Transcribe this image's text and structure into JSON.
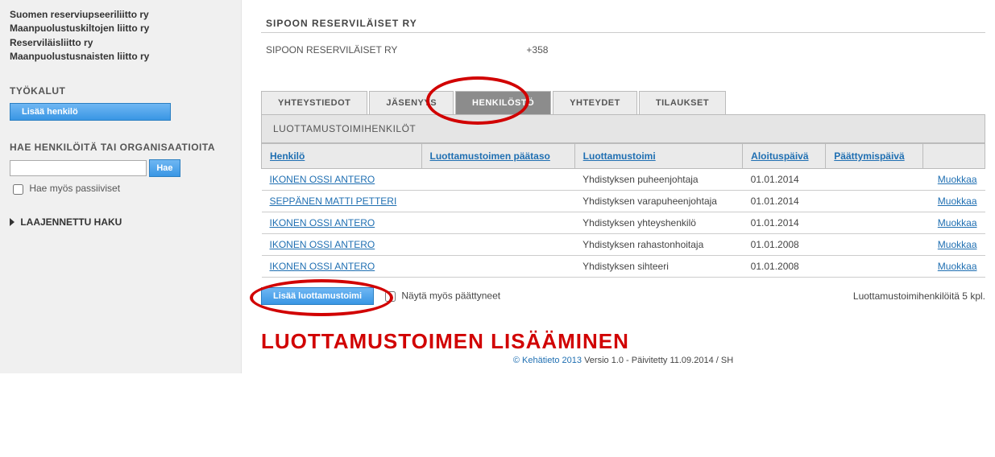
{
  "sidebar": {
    "organisations": [
      "Suomen reserviupseeriliitto ry",
      "Maanpuolustuskiltojen liitto ry",
      "Reserviläisliitto ry",
      "Maanpuolustusnaisten liitto ry"
    ],
    "tools_heading": "TYÖKALUT",
    "add_person_label": "Lisää henkilö",
    "search_heading": "HAE HENKILÖITÄ TAI ORGANISAATIOITA",
    "search_button_label": "Hae",
    "include_passive_label": "Hae myös passiiviset",
    "advanced_search_label": "LAAJENNETTU HAKU"
  },
  "main": {
    "title": "SIPOON RESERVILÄISET RY",
    "org_name": "SIPOON RESERVILÄISET RY",
    "phone": "+358",
    "tabs": [
      {
        "label": "YHTEYSTIEDOT"
      },
      {
        "label": "JÄSENYYS"
      },
      {
        "label": "HENKILÖSTÖ",
        "active": true
      },
      {
        "label": "YHTEYDET"
      },
      {
        "label": "TILAUKSET"
      }
    ],
    "section_heading": "LUOTTAMUSTOIMIHENKILÖT",
    "columns": {
      "person": "Henkilö",
      "main_level": "Luottamustoimen päätaso",
      "role": "Luottamustoimi",
      "start": "Aloituspäivä",
      "end": "Päättymispäivä"
    },
    "edit_label": "Muokkaa",
    "rows": [
      {
        "person": "IKONEN OSSI ANTERO",
        "main_level": "",
        "role": "Yhdistyksen puheenjohtaja",
        "start": "01.01.2014"
      },
      {
        "person": "SEPPÄNEN MATTI PETTERI",
        "main_level": "",
        "role": "Yhdistyksen varapuheenjohtaja",
        "start": "01.01.2014"
      },
      {
        "person": "IKONEN OSSI ANTERO",
        "main_level": "",
        "role": "Yhdistyksen yhteyshenkilö",
        "start": "01.01.2014"
      },
      {
        "person": "IKONEN OSSI ANTERO",
        "main_level": "",
        "role": "Yhdistyksen rahastonhoitaja",
        "start": "01.01.2008"
      },
      {
        "person": "IKONEN OSSI ANTERO",
        "main_level": "",
        "role": "Yhdistyksen sihteeri",
        "start": "01.01.2008"
      }
    ],
    "add_role_label": "Lisää luottamustoimi",
    "show_ended_label": "Näytä myös päättyneet",
    "count_text": "Luottamustoimihenkilöitä 5 kpl.",
    "instruction_text": "LUOTTAMUSTOIMEN LISÄÄMINEN",
    "footer": {
      "copy": "© Kehätieto 2013",
      "rest": " Versio 1.0 - Päivitetty 11.09.2014 / SH"
    }
  }
}
